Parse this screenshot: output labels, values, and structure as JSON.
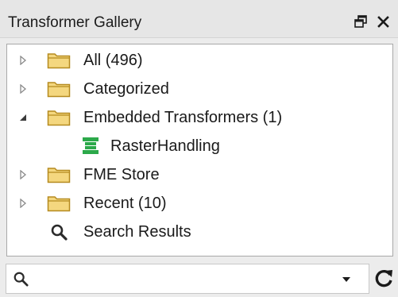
{
  "panel": {
    "title": "Transformer Gallery",
    "float_icon": "float-window-icon",
    "close_icon": "close-icon"
  },
  "tree": {
    "items": [
      {
        "label": "All (496)",
        "expanded": false,
        "icon": "folder-icon"
      },
      {
        "label": "Categorized",
        "expanded": false,
        "icon": "folder-icon"
      },
      {
        "label": "Embedded Transformers (1)",
        "expanded": true,
        "icon": "folder-icon",
        "children": [
          {
            "label": "RasterHandling",
            "icon": "transformer-icon"
          }
        ]
      },
      {
        "label": "FME Store",
        "expanded": false,
        "icon": "folder-icon"
      },
      {
        "label": "Recent (10)",
        "expanded": false,
        "icon": "folder-icon"
      },
      {
        "label": "Search Results",
        "icon": "search-icon"
      }
    ]
  },
  "search": {
    "value": "",
    "placeholder": "",
    "refresh_icon": "refresh-icon",
    "dropdown_icon": "dropdown-arrow-icon"
  },
  "colors": {
    "folder_fill": "#f4d77f",
    "folder_stroke": "#b58a1f",
    "transformer": "#2ca94a",
    "expander": "#8a8a8a"
  }
}
